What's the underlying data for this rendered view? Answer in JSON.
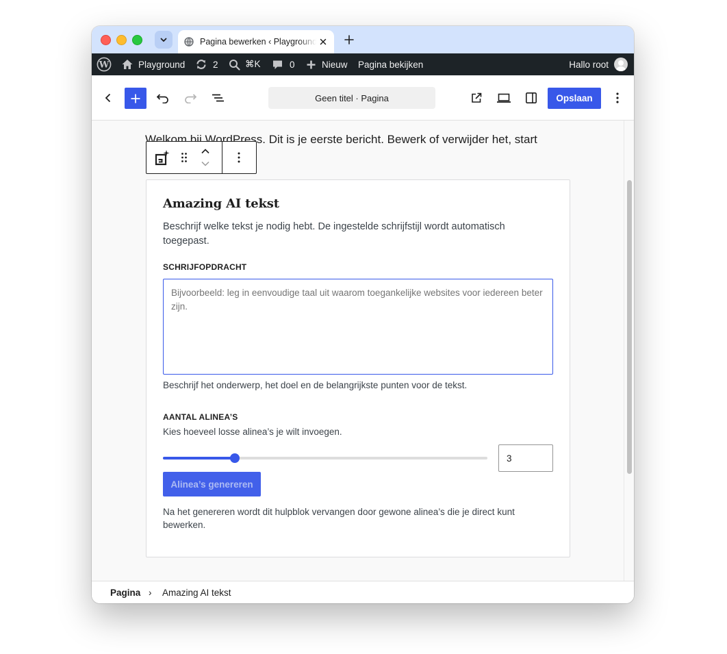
{
  "browser": {
    "tab_title": "Pagina bewerken ‹ Playground — WordPress",
    "new_tab_label": "+"
  },
  "adminbar": {
    "site_name": "Playground",
    "updates_count": "2",
    "search_shortcut": "⌘K",
    "comments_count": "0",
    "new_label": "Nieuw",
    "view_page_label": "Pagina bekijken",
    "greeting": "Hallo root"
  },
  "editor": {
    "document_title": "Geen titel · Pagina",
    "save_label": "Opslaan"
  },
  "canvas": {
    "intro_text": "Welkom bij WordPress. Dit is je eerste bericht. Bewerk of verwijder het, start"
  },
  "ai_block": {
    "title": "Amazing AI tekst",
    "description": "Beschrijf welke tekst je nodig hebt. De ingestelde schrijfstijl wordt automatisch toegepast.",
    "prompt_label": "SCHRIJFOPDRACHT",
    "prompt_value": "",
    "prompt_placeholder": "Bijvoorbeeld: leg in eenvoudige taal uit waarom toegankelijke websites voor iedereen beter zijn.",
    "prompt_help": "Beschrijf het onderwerp, het doel en de belangrijkste punten voor de tekst.",
    "paragraphs_label": "AANTAL ALINEA’S",
    "paragraphs_help": "Kies hoeveel losse alinea’s je wilt invoegen.",
    "paragraphs_value": "3",
    "slider_fraction": 0.222,
    "generate_label": "Alinea’s genereren",
    "footnote": "Na het genereren wordt dit hulpblok vervangen door gewone alinea’s die je direct kunt bewerken."
  },
  "breadcrumb": {
    "root": "Pagina",
    "separator": "›",
    "current": "Amazing AI tekst"
  },
  "colors": {
    "accent": "#3858e9",
    "adminbar": "#1d2327",
    "tabbar": "#d3e3fd"
  }
}
